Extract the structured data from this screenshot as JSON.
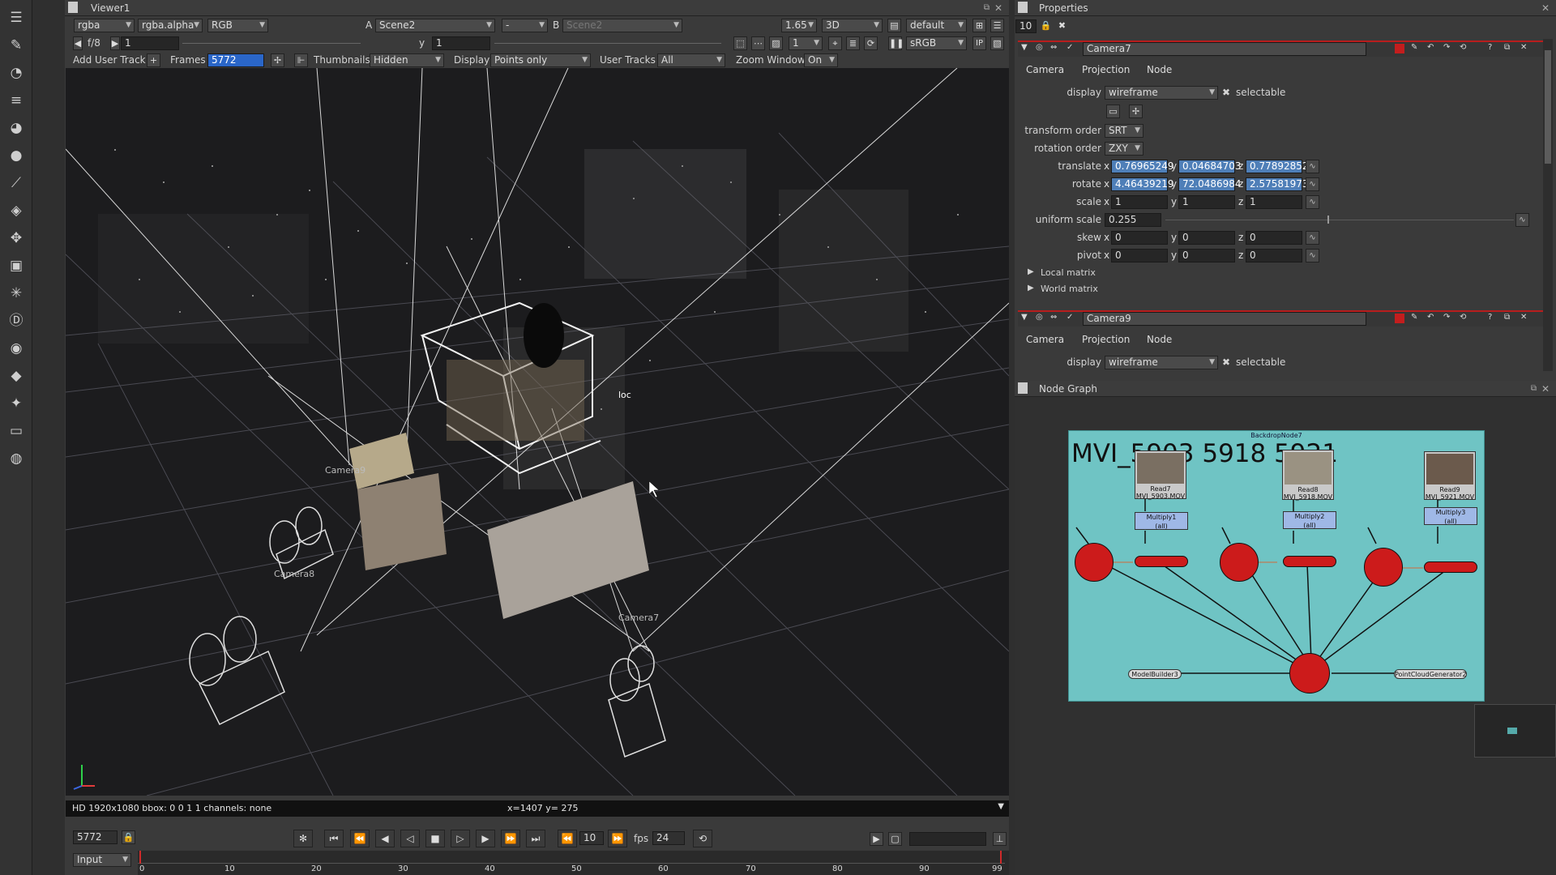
{
  "viewer": {
    "tab": "Viewer1",
    "channels": "rgba",
    "alpha": "rgba.alpha",
    "display_mode": "RGB",
    "a_label": "A",
    "input_a": "Scene2",
    "input_mid": "-",
    "b_label": "B",
    "input_b": "Scene2",
    "zoom": "1.65",
    "view": "3D",
    "lut_default": "default",
    "fstop": "f/8",
    "frame_field": "1",
    "y_label": "y",
    "y_value": "1",
    "proxy_value": "1",
    "colorspace": "sRGB",
    "ip_label": "IP",
    "toolbar2": {
      "add_user_track": "Add User Track",
      "frames_label": "Frames",
      "frames_value": "5772",
      "thumbnails_label": "Thumbnails",
      "thumbnails_value": "Hidden",
      "display_label": "Display",
      "display_value": "Points only",
      "user_tracks_label": "User Tracks",
      "user_tracks_value": "All",
      "zoom_window_label": "Zoom Window",
      "zoom_window_value": "On"
    },
    "scene_labels": {
      "camera9": "Camera9",
      "camera8": "Camera8",
      "camera7": "Camera7",
      "loc": "loc"
    },
    "status_left": "HD 1920x1080 bbox: 0 0 1 1 channels: none",
    "status_coords": "x=1407 y= 275",
    "transport": {
      "frame": "5772",
      "step": "10",
      "fps_label": "fps",
      "fps": "24",
      "input_mode": "Input"
    },
    "timeline_ticks": [
      "0",
      "10",
      "20",
      "30",
      "40",
      "50",
      "60",
      "70",
      "80",
      "90",
      "99"
    ]
  },
  "properties": {
    "tab": "Properties",
    "max_panels": "10",
    "camera7": {
      "name": "Camera7",
      "tabs": [
        "Camera",
        "Projection",
        "Node"
      ],
      "display_label": "display",
      "display_value": "wireframe",
      "selectable_label": "selectable",
      "transform_order_label": "transform order",
      "transform_order": "SRT",
      "rotation_order_label": "rotation order",
      "rotation_order": "ZXY",
      "translate_label": "translate",
      "translate": {
        "x": "0.76965249",
        "y": "0.04684703",
        "z": "0.77892852"
      },
      "rotate_label": "rotate",
      "rotate": {
        "x": "4.46439219",
        "y": "72.0486984",
        "z": "2.57581973"
      },
      "scale_label": "scale",
      "scale": {
        "x": "1",
        "y": "1",
        "z": "1"
      },
      "uniform_scale_label": "uniform scale",
      "uniform_scale": "0.255",
      "skew_label": "skew",
      "skew": {
        "x": "0",
        "y": "0",
        "z": "0"
      },
      "pivot_label": "pivot",
      "pivot": {
        "x": "0",
        "y": "0",
        "z": "0"
      },
      "local_matrix": "Local matrix",
      "world_matrix": "World matrix"
    },
    "camera9": {
      "name": "Camera9",
      "tabs": [
        "Camera",
        "Projection",
        "Node"
      ],
      "display_label": "display",
      "display_value": "wireframe",
      "selectable_label": "selectable"
    }
  },
  "node_graph": {
    "tab": "Node Graph",
    "backdrop_label": "BackdropNode7",
    "backdrop_title": "MVI_5903 5918 5921",
    "reads": [
      {
        "name": "Read7",
        "file": "MVI_5903.MOV"
      },
      {
        "name": "Read8",
        "file": "MVI_5918.MOV"
      },
      {
        "name": "Read9",
        "file": "MVI_5921.MOV"
      }
    ],
    "multiplies": [
      {
        "name": "Multiply1",
        "sub": "(all)"
      },
      {
        "name": "Multiply2",
        "sub": "(all)"
      },
      {
        "name": "Multiply3",
        "sub": "(all)"
      }
    ],
    "pills": {
      "left": "ModelBuilder3",
      "right": "PointCloudGenerator2"
    }
  },
  "colors": {
    "accent_red": "#b81d1d",
    "backdrop": "#6fc4c4",
    "selection_blue": "#4f7fb8",
    "frames_field": "#2a66c8"
  }
}
